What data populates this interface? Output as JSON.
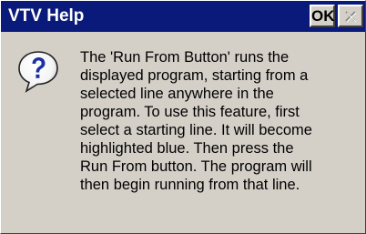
{
  "dialog": {
    "title": "VTV Help",
    "ok_label": "OK",
    "close_icon": "close-icon",
    "help_icon": "question-mark-speech-bubble-icon",
    "message_lines": [
      "The 'Run From Button' runs the",
      "displayed program, starting from a",
      "selected line anywhere in the",
      "program.  To use this feature, first",
      "select a starting line.  It will become",
      "highlighted blue.  Then press the",
      "Run From button.  The program will",
      "then begin running from that line."
    ]
  },
  "colors": {
    "titlebar": "#0a1a7a",
    "title_text": "#ffffff",
    "window_face": "#d4d0c8",
    "icon_fill": "#ffffff",
    "icon_mark": "#1a2fa8"
  }
}
